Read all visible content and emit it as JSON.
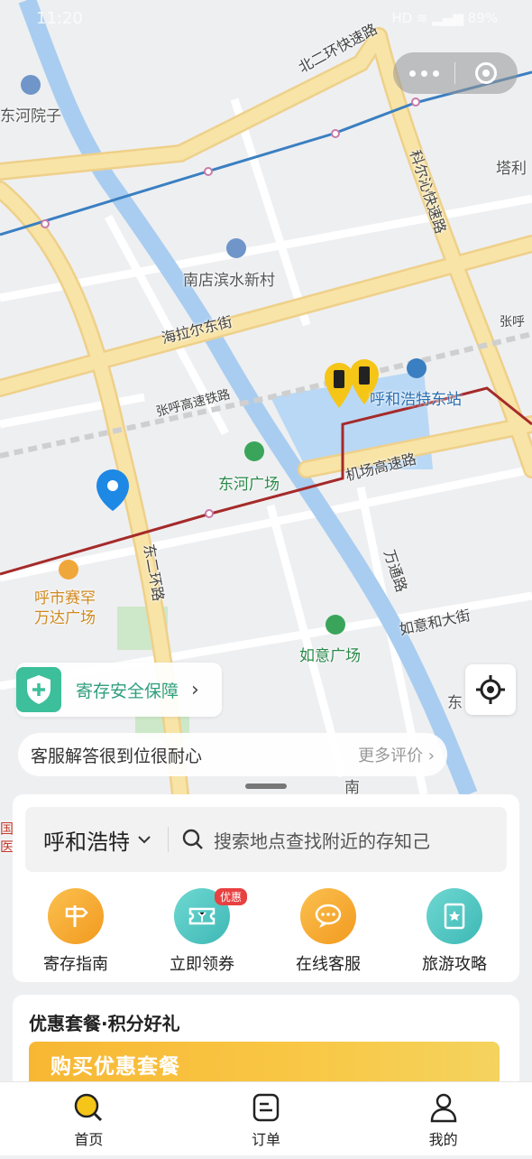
{
  "status_bar": {
    "time": "11:20",
    "right": "HD  ≋  ▂▄▆  89%"
  },
  "map": {
    "labels": {
      "dongheyuanzi": "东河院子",
      "bei_ring": "北二环快速路",
      "taliji": "塔利",
      "keerqin": "科尔沁快速路",
      "nandian": "南店滨水新村",
      "hailaer": "海拉尔东街",
      "zhanghu_rail": "张呼高速铁路",
      "zhanghu_right": "张呼",
      "huhe_station": "呼和浩特东站",
      "donghe_square": "东河广场",
      "airport_expy": "机场高速路",
      "dong_ring": "东二环路",
      "wantong": "万通路",
      "wanda": "呼市赛罕\n万达广场",
      "ruyi_street": "如意和大街",
      "ruyi_square": "如意广场",
      "dong_right": "东",
      "south": "南",
      "road_small": "路",
      "guo_yuan": "国\n医院"
    },
    "colors": {
      "road": "#f8e4a6",
      "road_edge": "#eed08a",
      "river": "#a9cdf0",
      "rail": "#3a7fc1",
      "metro_red": "#a52a2a",
      "pin": "#1e88e5"
    }
  },
  "safety": {
    "label": "寄存安全保障"
  },
  "review": {
    "text": "客服解答很到位很耐心",
    "more": "更多评价"
  },
  "search": {
    "city": "呼和浩特",
    "placeholder": "搜索地点查找附近的存知己"
  },
  "quick_actions": [
    {
      "label": "寄存指南",
      "icon": "signpost-icon",
      "color": "#f7a42c"
    },
    {
      "label": "立即领券",
      "icon": "coupon-icon",
      "color": "#4ec9c4",
      "badge": "优惠"
    },
    {
      "label": "在线客服",
      "icon": "chat-icon",
      "color": "#f7a42c"
    },
    {
      "label": "旅游攻略",
      "icon": "guidebook-icon",
      "color": "#4ec9c4"
    }
  ],
  "promo": {
    "title": "优惠套餐·积分好礼",
    "banner": "购买优惠套餐"
  },
  "tabs": [
    {
      "label": "首页",
      "icon": "home-search-icon"
    },
    {
      "label": "订单",
      "icon": "order-icon"
    },
    {
      "label": "我的",
      "icon": "profile-icon"
    }
  ]
}
